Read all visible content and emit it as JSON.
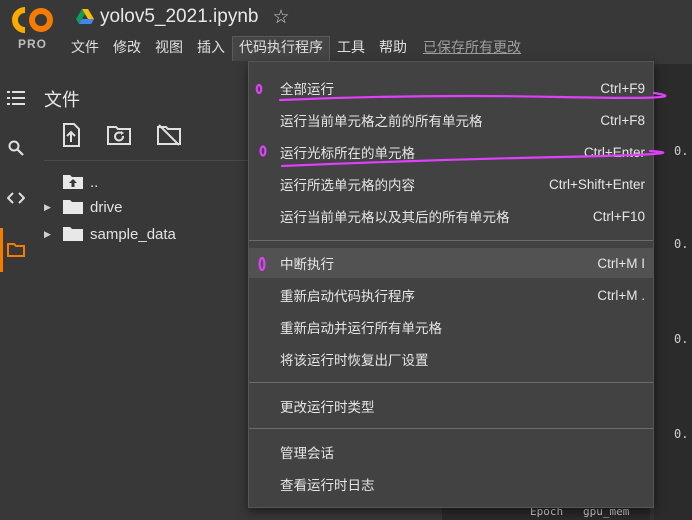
{
  "app": {
    "logo_text": "CO",
    "logo_badge": "PRO",
    "notebook_title": "yolov5_2021.ipynb",
    "icons": [
      "colab-logo",
      "drive-icon",
      "star-icon"
    ]
  },
  "menu_bar": {
    "items": [
      "文件",
      "修改",
      "视图",
      "插入",
      "代码执行程序",
      "工具",
      "帮助"
    ],
    "active": "代码执行程序",
    "saved_status": "已保存所有更改"
  },
  "left_rail": {
    "icons": [
      "list-icon",
      "search-icon",
      "code-icon",
      "folder-icon"
    ],
    "active": "folder-icon",
    "accent_color": "#f57c00"
  },
  "files_panel": {
    "title": "文件",
    "toolbar_icons": [
      "upload-icon",
      "refresh-folder-icon",
      "hide-drive-icon"
    ],
    "tree": [
      {
        "name": "..",
        "type": "parent"
      },
      {
        "name": "drive",
        "type": "folder"
      },
      {
        "name": "sample_data",
        "type": "folder"
      }
    ]
  },
  "notebook": {
    "outputs": [
      "0.",
      "0.",
      "0.",
      "0."
    ],
    "footer_text": "Epoch   gpu_mem"
  },
  "runtime_menu": {
    "groups": [
      [
        {
          "label": "全部运行",
          "shortcut": "Ctrl+F9"
        },
        {
          "label": "运行当前单元格之前的所有单元格",
          "shortcut": "Ctrl+F8"
        },
        {
          "label": "运行光标所在的单元格",
          "shortcut": "Ctrl+Enter"
        },
        {
          "label": "运行所选单元格的内容",
          "shortcut": "Ctrl+Shift+Enter"
        },
        {
          "label": "运行当前单元格以及其后的所有单元格",
          "shortcut": "Ctrl+F10"
        }
      ],
      [
        {
          "label": "中断执行",
          "shortcut": "Ctrl+M I"
        },
        {
          "label": "重新启动代码执行程序",
          "shortcut": "Ctrl+M ."
        },
        {
          "label": "重新启动并运行所有单元格",
          "shortcut": ""
        },
        {
          "label": "将该运行时恢复出厂设置",
          "shortcut": ""
        }
      ],
      [
        {
          "label": "更改运行时类型",
          "shortcut": ""
        }
      ],
      [
        {
          "label": "管理会话",
          "shortcut": ""
        },
        {
          "label": "查看运行时日志",
          "shortcut": ""
        }
      ]
    ],
    "hovered": "中断执行",
    "annotation_color": "#e040fb"
  }
}
